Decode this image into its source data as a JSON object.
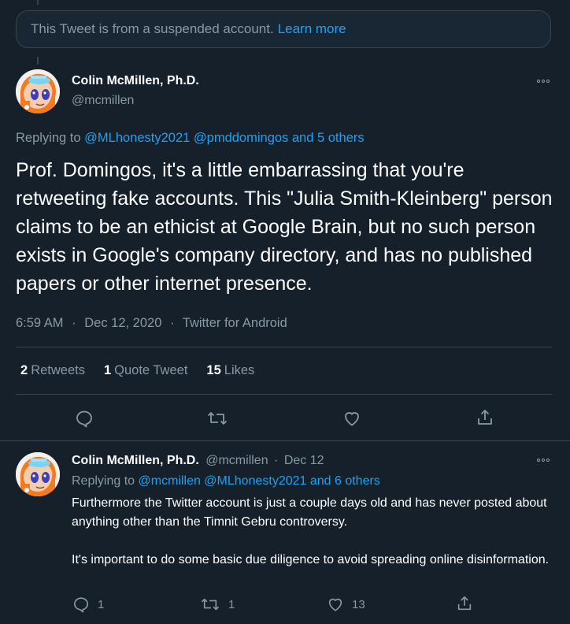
{
  "suspended_notice": {
    "text": "This Tweet is from a suspended account.",
    "link": "Learn more"
  },
  "main_tweet": {
    "author_name": "Colin McMillen, Ph.D.",
    "handle": "@mcmillen",
    "replying_prefix": "Replying to",
    "replying_mentions": "@MLhonesty2021 @pmddomingos and 5 others",
    "text": "Prof. Domingos, it's a little embarrassing that you're retweeting fake accounts. This \"Julia Smith-Kleinberg\" person claims to be an ethicist at Google Brain, but no such person exists in Google's company directory, and has no published papers or other internet presence.",
    "time": "6:59 AM",
    "date": "Dec 12, 2020",
    "source": "Twitter for Android",
    "stats": {
      "retweets_count": "2",
      "retweets_label": "Retweets",
      "quotes_count": "1",
      "quotes_label": "Quote Tweet",
      "likes_count": "15",
      "likes_label": "Likes"
    }
  },
  "reply_tweet": {
    "author_name": "Colin McMillen, Ph.D.",
    "handle": "@mcmillen",
    "separator": "·",
    "date": "Dec 12",
    "replying_prefix": "Replying to",
    "replying_mentions": "@mcmillen @MLhonesty2021 and 6 others",
    "paragraph_1": "Furthermore the Twitter account is just a couple days old and has never posted about anything other than the Timnit Gebru controversy.",
    "paragraph_2": "It's important to do some basic due diligence to avoid spreading online disinformation.",
    "reply_count": "1",
    "retweet_count": "1",
    "like_count": "13"
  },
  "meta_separator": "·",
  "colors": {
    "background": "#15202b",
    "accent": "#1da1f2",
    "muted": "#8899a6",
    "border": "#38444d"
  },
  "icons": [
    "more-icon",
    "reply-icon",
    "retweet-icon",
    "like-icon",
    "share-icon"
  ]
}
